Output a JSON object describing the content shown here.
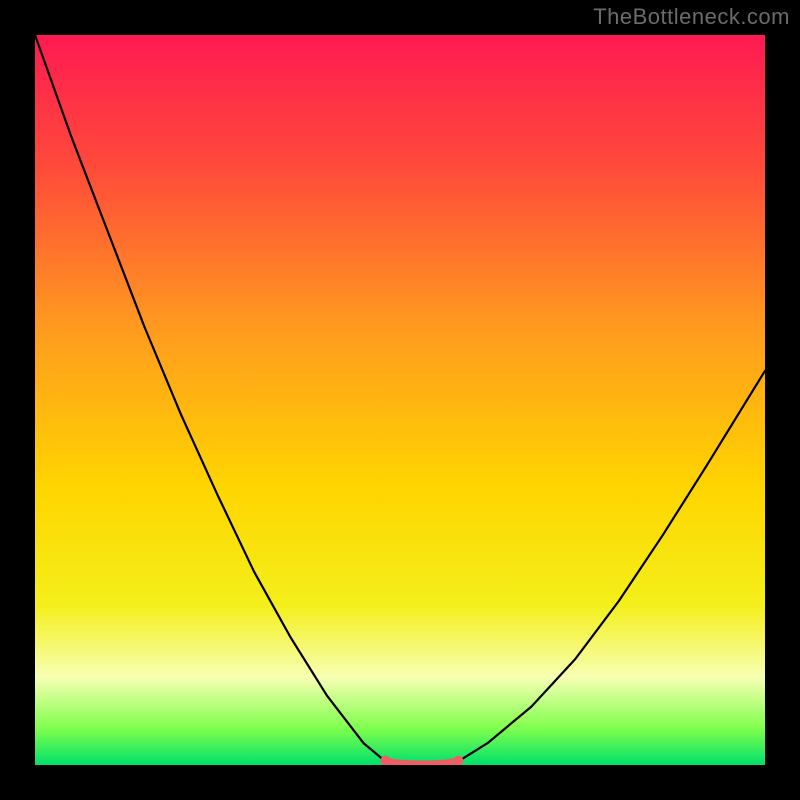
{
  "watermark": "TheBottleneck.com",
  "chart_data": {
    "type": "line",
    "title": "",
    "xlabel": "",
    "ylabel": "",
    "xlim": [
      0,
      100
    ],
    "ylim": [
      0,
      100
    ],
    "grid": false,
    "legend": false,
    "background_gradient": {
      "stops": [
        {
          "pos": 0.0,
          "color": "#ff1a52"
        },
        {
          "pos": 0.18,
          "color": "#ff4a3a"
        },
        {
          "pos": 0.4,
          "color": "#ff9a1f"
        },
        {
          "pos": 0.62,
          "color": "#ffd500"
        },
        {
          "pos": 0.78,
          "color": "#f4ef1a"
        },
        {
          "pos": 0.88,
          "color": "#f7ffb3"
        },
        {
          "pos": 0.95,
          "color": "#7fff4d"
        },
        {
          "pos": 1.0,
          "color": "#00e06b"
        }
      ]
    },
    "series": [
      {
        "name": "curve-left",
        "color": "#000000",
        "width": 2.2,
        "x": [
          0.0,
          5.0,
          10.0,
          15.0,
          20.0,
          25.0,
          30.0,
          35.0,
          40.0,
          45.0,
          48.0
        ],
        "y": [
          100.0,
          86.0,
          73.0,
          60.0,
          48.0,
          37.0,
          26.5,
          17.5,
          9.5,
          3.0,
          0.5
        ]
      },
      {
        "name": "curve-right",
        "color": "#000000",
        "width": 2.2,
        "x": [
          58.0,
          62.0,
          68.0,
          74.0,
          80.0,
          86.0,
          92.0,
          100.0
        ],
        "y": [
          0.5,
          3.0,
          8.0,
          14.5,
          22.5,
          31.5,
          41.0,
          54.0
        ]
      },
      {
        "name": "bottom-flat",
        "color": "#ef5d66",
        "width": 7.5,
        "x": [
          48.0,
          50.0,
          52.0,
          54.0,
          56.0,
          58.0
        ],
        "y": [
          0.5,
          0.2,
          0.1,
          0.1,
          0.2,
          0.5
        ]
      }
    ],
    "markers": [
      {
        "name": "left-end-dot",
        "x": 48.0,
        "y": 0.6,
        "r": 5,
        "color": "#ef5d66"
      },
      {
        "name": "right-end-dot",
        "x": 58.0,
        "y": 0.6,
        "r": 5,
        "color": "#ef5d66"
      }
    ]
  }
}
